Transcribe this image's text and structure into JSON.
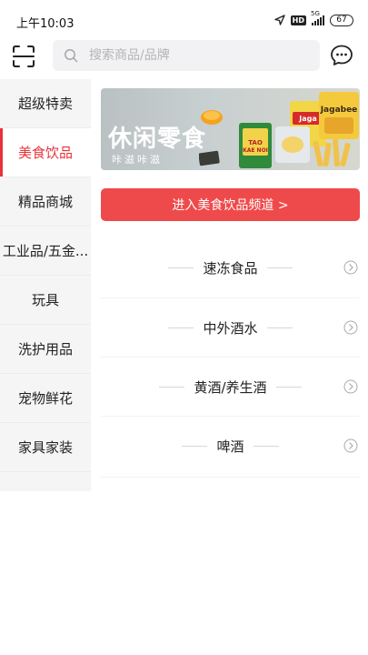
{
  "status_bar": {
    "time": "上午10:03",
    "hd": "HD",
    "network": "5G",
    "battery": "67"
  },
  "search": {
    "placeholder": "搜索商品/品牌"
  },
  "sidebar": {
    "items": [
      {
        "label": "超级特卖"
      },
      {
        "label": "美食饮品",
        "active": true
      },
      {
        "label": "精品商城"
      },
      {
        "label": "工业品/五金..."
      },
      {
        "label": "玩具"
      },
      {
        "label": "洗护用品"
      },
      {
        "label": "宠物鲜花"
      },
      {
        "label": "家具家装"
      }
    ]
  },
  "banner": {
    "title": "休闲零食",
    "subtitle": "咔滋咔滋",
    "brand_text_1": "Jagabee",
    "brand_text_2": "Tao Kae Noi"
  },
  "enter_button": {
    "label": "进入美食饮品频道 >"
  },
  "categories": [
    {
      "label": "速冻食品"
    },
    {
      "label": "中外酒水"
    },
    {
      "label": "黄酒/养生酒"
    },
    {
      "label": "啤酒"
    }
  ],
  "colors": {
    "accent": "#e8323a",
    "button": "#ef4a4b",
    "sidebar_bg": "#f5f5f5"
  }
}
